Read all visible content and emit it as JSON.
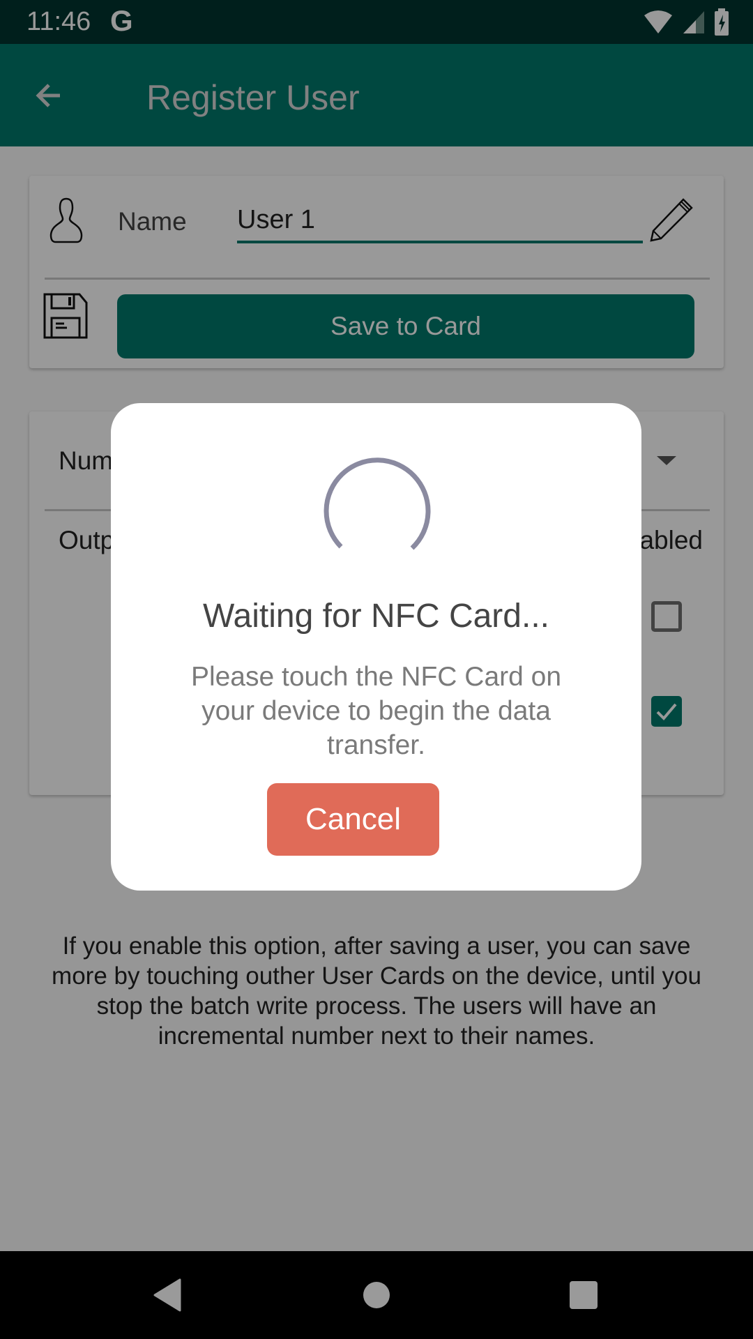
{
  "status_bar": {
    "time": "11:46",
    "notification_icon": "google-g-icon",
    "icons": [
      "wifi-icon",
      "cellular-signal-icon",
      "battery-charging-icon"
    ]
  },
  "app_bar": {
    "back_icon": "arrow-back-icon",
    "title": "Register User",
    "color": "#00796b"
  },
  "user_card": {
    "user_icon": "person-outline-icon",
    "name_label": "Name",
    "name_value": "User 1",
    "edit_icon": "pencil-icon",
    "save_icon": "floppy-disk-icon",
    "save_button_label": "Save to Card"
  },
  "settings_card": {
    "number_label": "Num",
    "output_label": "Outp",
    "enabled_label": "abled",
    "checkboxes": [
      {
        "checked": false
      },
      {
        "checked": true
      }
    ]
  },
  "batch_info": "If you enable this option, after saving a user, you can save more by touching outher User Cards on the device, until you stop the batch write process. The users will have an incremental number next to their names.",
  "dialog": {
    "title": "Waiting for NFC Card...",
    "message": "Please touch the NFC Card on your device to begin the data transfer.",
    "cancel_label": "Cancel",
    "cancel_color": "#e06b58",
    "spinner_color": "#8a8aa0"
  },
  "nav_bar": {
    "back": "nav-back-icon",
    "home": "nav-home-icon",
    "recents": "nav-recents-icon"
  }
}
